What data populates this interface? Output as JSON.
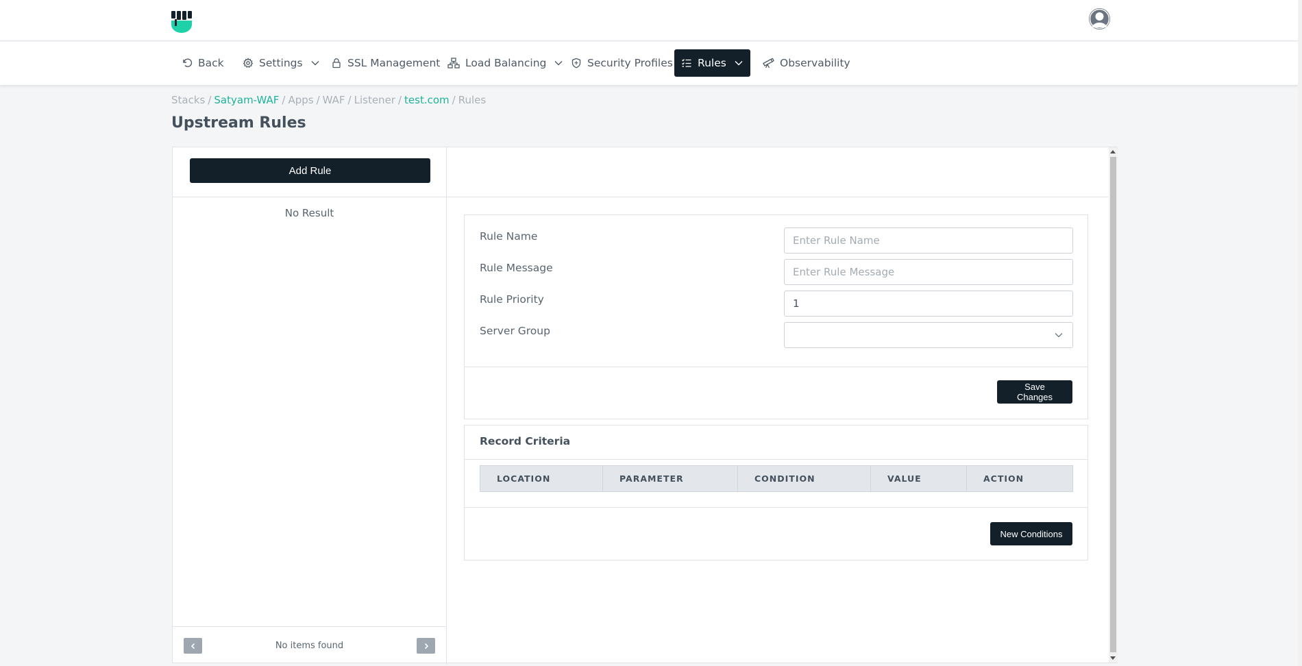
{
  "nav": {
    "items": [
      {
        "label": "Back",
        "icon": "back-arrow-icon"
      },
      {
        "label": "Settings",
        "icon": "gear-icon",
        "dropdown": true
      },
      {
        "label": "SSL Management",
        "icon": "lock-icon"
      },
      {
        "label": "Load Balancing",
        "icon": "network-icon",
        "dropdown": true
      },
      {
        "label": "Security Profiles",
        "icon": "shield-icon"
      },
      {
        "label": "Rules",
        "icon": "list-check-icon",
        "dropdown": true,
        "active": true
      },
      {
        "label": "Observability",
        "icon": "telescope-icon"
      }
    ]
  },
  "breadcrumb": {
    "items": [
      {
        "label": "Stacks",
        "link": false
      },
      {
        "label": "Satyam-WAF",
        "link": true
      },
      {
        "label": "Apps",
        "link": false
      },
      {
        "label": "WAF",
        "link": false
      },
      {
        "label": "Listener",
        "link": false
      },
      {
        "label": "test.com",
        "link": true
      },
      {
        "label": "Rules",
        "link": false
      }
    ],
    "separator": "/"
  },
  "page": {
    "title": "Upstream Rules"
  },
  "left_panel": {
    "add_button": "Add Rule",
    "empty_text": "No Result",
    "pagination_text": "No items found"
  },
  "form": {
    "rule_name_label": "Rule Name",
    "rule_name_placeholder": "Enter Rule Name",
    "rule_message_label": "Rule Message",
    "rule_message_placeholder": "Enter Rule Message",
    "rule_priority_label": "Rule Priority",
    "rule_priority_value": "1",
    "server_group_label": "Server Group",
    "server_group_value": "",
    "save_button": "Save Changes"
  },
  "criteria": {
    "title": "Record Criteria",
    "columns": [
      "LOCATION",
      "PARAMETER",
      "CONDITION",
      "VALUE",
      "ACTION"
    ],
    "new_button": "New Conditions"
  },
  "colors": {
    "accent": "#1fb29a",
    "dark": "#13202a",
    "table_header_bg": "#e3e7ec"
  }
}
